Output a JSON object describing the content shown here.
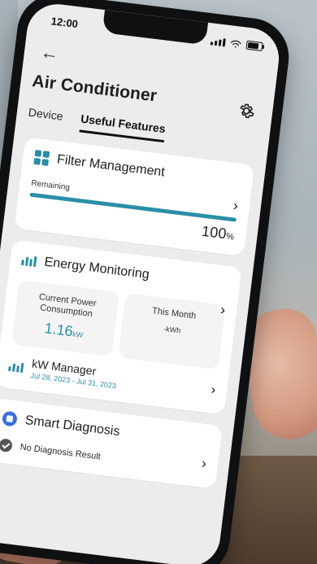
{
  "status_bar": {
    "time": "12:00"
  },
  "app": {
    "title": "Air Conditioner",
    "tabs": [
      {
        "label": "Device",
        "active": false
      },
      {
        "label": "Useful Features",
        "active": true
      }
    ]
  },
  "filter_management": {
    "title": "Filter Management",
    "remaining_label": "Remaining",
    "remaining_percent": 100,
    "remaining_value": "100",
    "remaining_unit": "%"
  },
  "energy_monitoring": {
    "title": "Energy Monitoring",
    "current_power_label": "Current Power\nConsumption",
    "current_power_value": "1.16",
    "current_power_unit": "kW",
    "this_month_label": "This Month",
    "this_month_value": "-kWh"
  },
  "kw_manager": {
    "title": "kW Manager",
    "dates": "Jul 28, 2023 - Jul 31, 2023"
  },
  "smart_diagnosis": {
    "title": "Smart Diagnosis",
    "result": "No Diagnosis Result"
  },
  "colors": {
    "accent": "#2a8fa6",
    "diagnosis_icon": "#3b6fe0"
  },
  "icons": {
    "back": "back-arrow-icon",
    "settings": "gear-icon",
    "filter": "filter-grid-icon",
    "energy": "bar-chart-icon",
    "kw_manager": "kw-chart-icon",
    "diagnosis": "diagnosis-icon",
    "check": "check-circle-icon",
    "chevron": "chevron-right-icon"
  }
}
